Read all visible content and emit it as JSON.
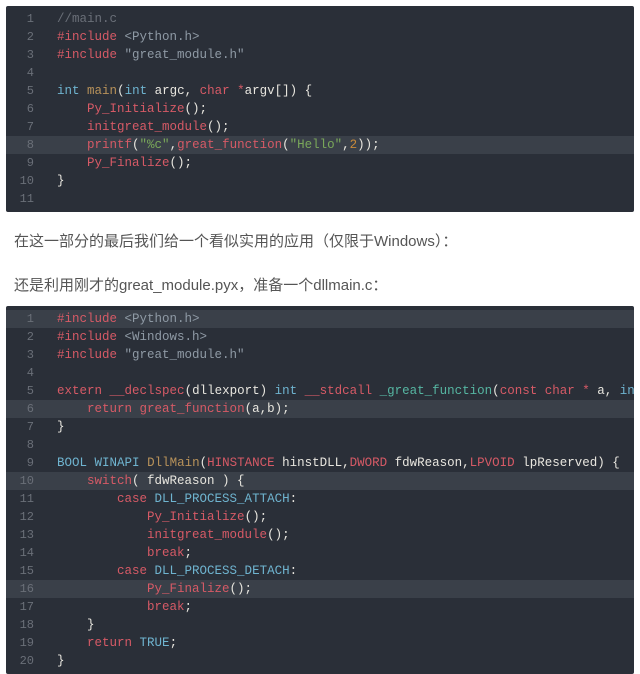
{
  "block1": {
    "lines": [
      {
        "n": "1",
        "hl": false,
        "tokens": [
          [
            "  ",
            "c-plain"
          ],
          [
            "//main.c",
            "c-comment"
          ]
        ]
      },
      {
        "n": "2",
        "hl": false,
        "tokens": [
          [
            "  ",
            "c-plain"
          ],
          [
            "#include ",
            "c-prep"
          ],
          [
            "<Python.h>",
            "c-prepstr"
          ]
        ]
      },
      {
        "n": "3",
        "hl": false,
        "tokens": [
          [
            "  ",
            "c-plain"
          ],
          [
            "#include ",
            "c-prep"
          ],
          [
            "\"great_module.h\"",
            "c-prepstr"
          ]
        ]
      },
      {
        "n": "4",
        "hl": false,
        "tokens": []
      },
      {
        "n": "5",
        "hl": false,
        "tokens": [
          [
            "  ",
            "c-plain"
          ],
          [
            "int",
            "c-type"
          ],
          [
            " ",
            "c-plain"
          ],
          [
            "main",
            "c-func"
          ],
          [
            "(",
            "c-plain"
          ],
          [
            "int",
            "c-type"
          ],
          [
            " argc, ",
            "c-plain"
          ],
          [
            "char",
            "c-char"
          ],
          [
            " ",
            "c-plain"
          ],
          [
            "*",
            "c-star"
          ],
          [
            "argv[]) {",
            "c-plain"
          ]
        ]
      },
      {
        "n": "6",
        "hl": false,
        "tokens": [
          [
            "      ",
            "c-plain"
          ],
          [
            "Py_Initialize",
            "c-call"
          ],
          [
            "();",
            "c-plain"
          ]
        ]
      },
      {
        "n": "7",
        "hl": false,
        "tokens": [
          [
            "      ",
            "c-plain"
          ],
          [
            "initgreat_module",
            "c-call"
          ],
          [
            "();",
            "c-plain"
          ]
        ]
      },
      {
        "n": "8",
        "hl": true,
        "tokens": [
          [
            "      ",
            "c-plain"
          ],
          [
            "printf",
            "c-call"
          ],
          [
            "(",
            "c-plain"
          ],
          [
            "\"%c\"",
            "c-str"
          ],
          [
            ",",
            "c-plain"
          ],
          [
            "great_function",
            "c-call"
          ],
          [
            "(",
            "c-plain"
          ],
          [
            "\"Hello\"",
            "c-str"
          ],
          [
            ",",
            "c-plain"
          ],
          [
            "2",
            "c-num"
          ],
          [
            "));",
            "c-plain"
          ]
        ]
      },
      {
        "n": "9",
        "hl": false,
        "tokens": [
          [
            "      ",
            "c-plain"
          ],
          [
            "Py_Finalize",
            "c-call"
          ],
          [
            "();",
            "c-plain"
          ]
        ]
      },
      {
        "n": "10",
        "hl": false,
        "tokens": [
          [
            "  }",
            "c-plain"
          ]
        ]
      },
      {
        "n": "11",
        "hl": false,
        "tokens": []
      }
    ]
  },
  "prose1": "在这一部分的最后我们给一个看似实用的应用（仅限于Windows）：",
  "prose2": "还是利用刚才的great_module.pyx，准备一个dllmain.c：",
  "block2": {
    "lines": [
      {
        "n": "1",
        "hl": true,
        "tokens": [
          [
            "  ",
            "c-plain"
          ],
          [
            "#include ",
            "c-prep"
          ],
          [
            "<Python.h>",
            "c-prepstr"
          ]
        ]
      },
      {
        "n": "2",
        "hl": false,
        "tokens": [
          [
            "  ",
            "c-plain"
          ],
          [
            "#include ",
            "c-prep"
          ],
          [
            "<Windows.h>",
            "c-prepstr"
          ]
        ]
      },
      {
        "n": "3",
        "hl": false,
        "tokens": [
          [
            "  ",
            "c-plain"
          ],
          [
            "#include ",
            "c-prep"
          ],
          [
            "\"great_module.h\"",
            "c-prepstr"
          ]
        ]
      },
      {
        "n": "4",
        "hl": false,
        "tokens": []
      },
      {
        "n": "5",
        "hl": false,
        "tokens": [
          [
            "  ",
            "c-plain"
          ],
          [
            "extern",
            "c-kw"
          ],
          [
            " ",
            "c-plain"
          ],
          [
            "__declspec",
            "c-call"
          ],
          [
            "(dllexport) ",
            "c-plain"
          ],
          [
            "int",
            "c-type"
          ],
          [
            " ",
            "c-plain"
          ],
          [
            "__stdcall",
            "c-call"
          ],
          [
            " ",
            "c-plain"
          ],
          [
            "_great_function",
            "c-teal"
          ],
          [
            "(",
            "c-plain"
          ],
          [
            "const",
            "c-kw"
          ],
          [
            " ",
            "c-plain"
          ],
          [
            "char",
            "c-char"
          ],
          [
            " ",
            "c-plain"
          ],
          [
            "*",
            "c-star"
          ],
          [
            " a, ",
            "c-plain"
          ],
          [
            "int",
            "c-type"
          ]
        ]
      },
      {
        "n": "6",
        "hl": true,
        "tokens": [
          [
            "      ",
            "c-plain"
          ],
          [
            "return",
            "c-kw"
          ],
          [
            " ",
            "c-plain"
          ],
          [
            "great_function",
            "c-call"
          ],
          [
            "(a,b);",
            "c-plain"
          ]
        ]
      },
      {
        "n": "7",
        "hl": false,
        "tokens": [
          [
            "  }",
            "c-plain"
          ]
        ]
      },
      {
        "n": "8",
        "hl": false,
        "tokens": []
      },
      {
        "n": "9",
        "hl": false,
        "tokens": [
          [
            "  ",
            "c-plain"
          ],
          [
            "BOOL",
            "c-kw2"
          ],
          [
            " ",
            "c-plain"
          ],
          [
            "WINAPI",
            "c-kw2"
          ],
          [
            " ",
            "c-plain"
          ],
          [
            "DllMain",
            "c-func"
          ],
          [
            "(",
            "c-plain"
          ],
          [
            "HINSTANCE",
            "c-call"
          ],
          [
            " hinstDLL,",
            "c-plain"
          ],
          [
            "DWORD",
            "c-call"
          ],
          [
            " fdwReason,",
            "c-plain"
          ],
          [
            "LPVOID",
            "c-call"
          ],
          [
            " lpReserved) {",
            "c-plain"
          ]
        ]
      },
      {
        "n": "10",
        "hl": true,
        "tokens": [
          [
            "      ",
            "c-plain"
          ],
          [
            "switch",
            "c-kw"
          ],
          [
            "( fdwReason ) {",
            "c-plain"
          ]
        ]
      },
      {
        "n": "11",
        "hl": false,
        "tokens": [
          [
            "          ",
            "c-plain"
          ],
          [
            "case",
            "c-kw"
          ],
          [
            " ",
            "c-plain"
          ],
          [
            "DLL_PROCESS_ATTACH",
            "c-const"
          ],
          [
            ":",
            "c-plain"
          ]
        ]
      },
      {
        "n": "12",
        "hl": false,
        "tokens": [
          [
            "              ",
            "c-plain"
          ],
          [
            "Py_Initialize",
            "c-call"
          ],
          [
            "();",
            "c-plain"
          ]
        ]
      },
      {
        "n": "13",
        "hl": false,
        "tokens": [
          [
            "              ",
            "c-plain"
          ],
          [
            "initgreat_module",
            "c-call"
          ],
          [
            "();",
            "c-plain"
          ]
        ]
      },
      {
        "n": "14",
        "hl": false,
        "tokens": [
          [
            "              ",
            "c-plain"
          ],
          [
            "break",
            "c-kw"
          ],
          [
            ";",
            "c-plain"
          ]
        ]
      },
      {
        "n": "15",
        "hl": false,
        "tokens": [
          [
            "          ",
            "c-plain"
          ],
          [
            "case",
            "c-kw"
          ],
          [
            " ",
            "c-plain"
          ],
          [
            "DLL_PROCESS_DETACH",
            "c-const"
          ],
          [
            ":",
            "c-plain"
          ]
        ]
      },
      {
        "n": "16",
        "hl": true,
        "tokens": [
          [
            "              ",
            "c-plain"
          ],
          [
            "Py_Finalize",
            "c-call"
          ],
          [
            "();",
            "c-plain"
          ]
        ]
      },
      {
        "n": "17",
        "hl": false,
        "tokens": [
          [
            "              ",
            "c-plain"
          ],
          [
            "break",
            "c-kw"
          ],
          [
            ";",
            "c-plain"
          ]
        ]
      },
      {
        "n": "18",
        "hl": false,
        "tokens": [
          [
            "      }",
            "c-plain"
          ]
        ]
      },
      {
        "n": "19",
        "hl": false,
        "tokens": [
          [
            "      ",
            "c-plain"
          ],
          [
            "return",
            "c-kw"
          ],
          [
            " ",
            "c-plain"
          ],
          [
            "TRUE",
            "c-const"
          ],
          [
            ";",
            "c-plain"
          ]
        ]
      },
      {
        "n": "20",
        "hl": false,
        "tokens": [
          [
            "  }",
            "c-plain"
          ]
        ]
      }
    ]
  }
}
